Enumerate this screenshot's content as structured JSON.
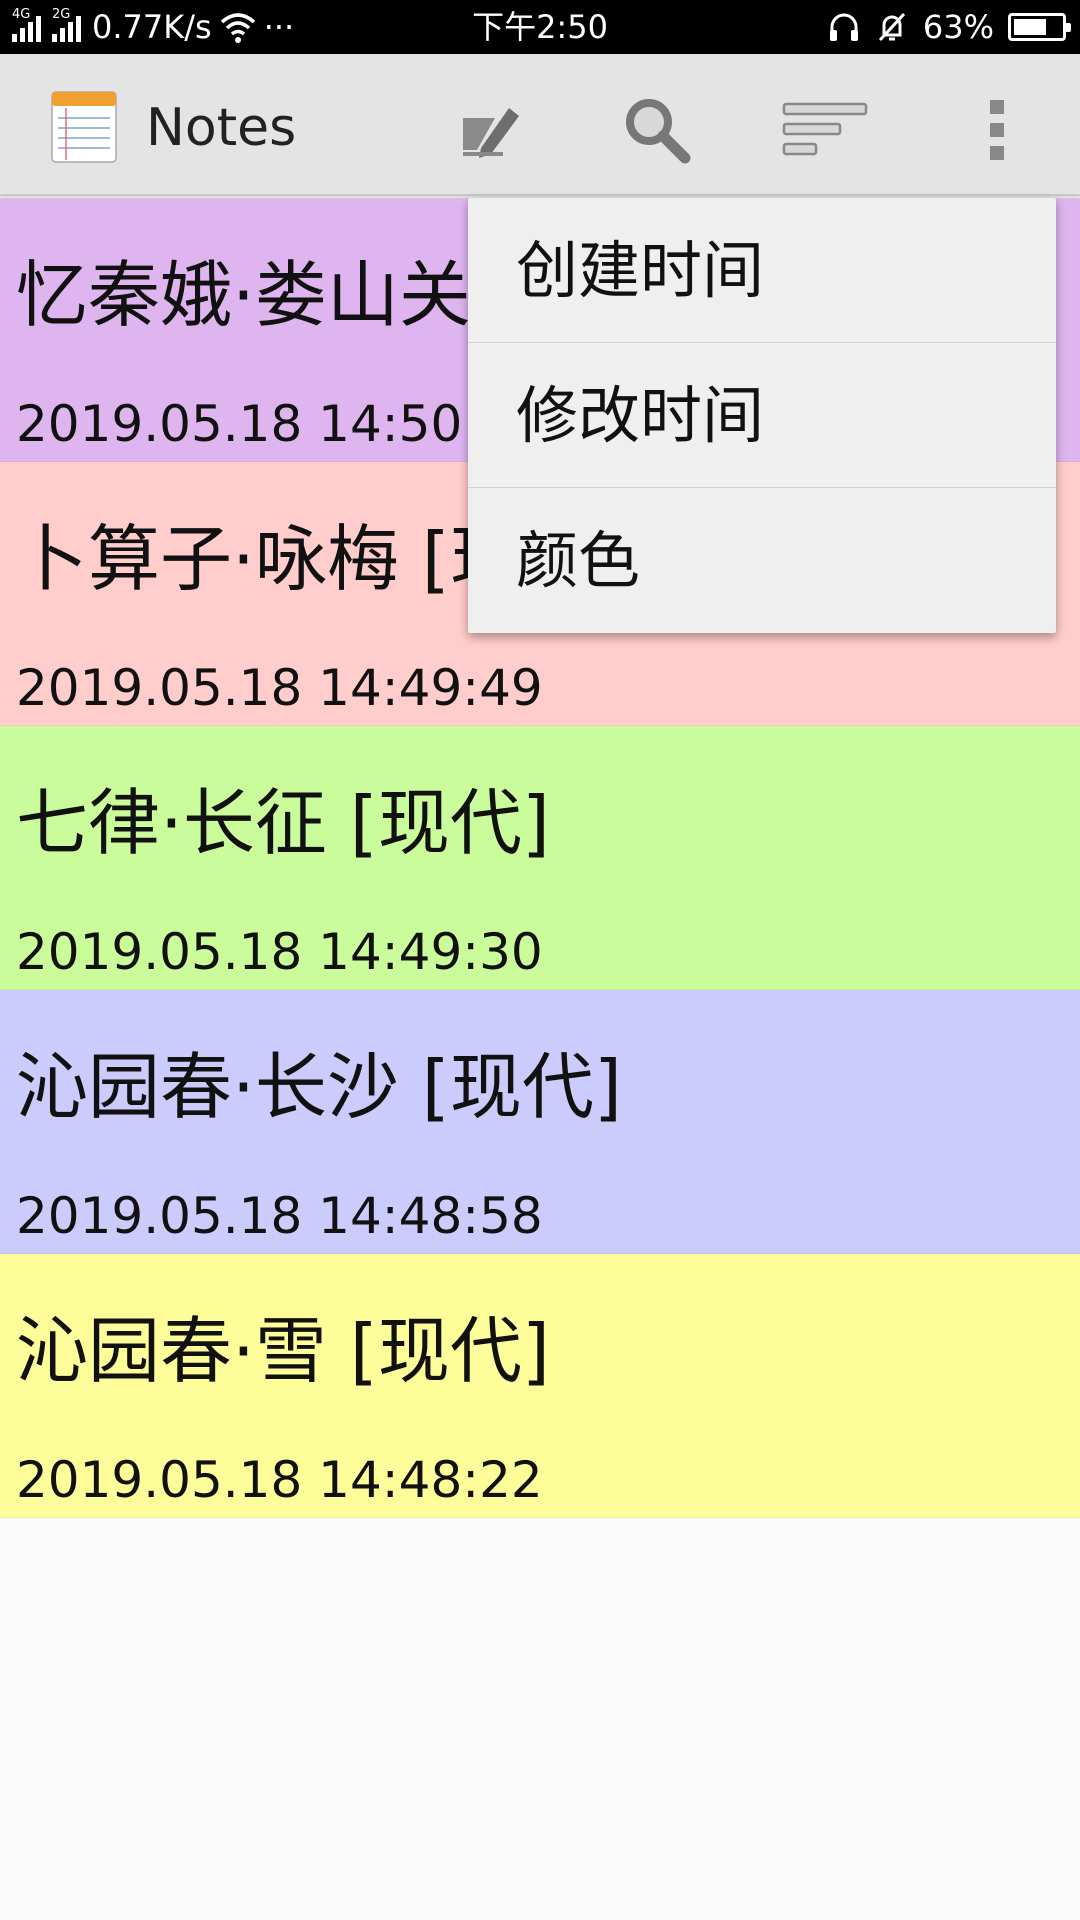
{
  "status_bar": {
    "network_1": "4G",
    "network_2": "2G",
    "speed": "0.77K/s",
    "more": "···",
    "time": "下午2:50",
    "battery": "63%",
    "icons": [
      "signal-icon",
      "wifi-icon",
      "headphone-icon",
      "mute-bell-icon",
      "battery-icon"
    ]
  },
  "action_bar": {
    "title": "Notes",
    "icons": [
      "notes-app-icon",
      "new-note-icon",
      "search-icon",
      "sort-icon",
      "overflow-menu-icon"
    ]
  },
  "notes": [
    {
      "title": "忆秦娥·娄山关 [现代]",
      "date": "2019.05.18 14:50:0",
      "color": "#dfb5f0"
    },
    {
      "title": "卜算子·咏梅 [现代]",
      "date": "2019.05.18 14:49:49",
      "color": "#ffcdcb"
    },
    {
      "title": "七律·长征 [现代]",
      "date": "2019.05.18 14:49:30",
      "color": "#cbfc9b"
    },
    {
      "title": "沁园春·长沙 [现代]",
      "date": "2019.05.18 14:48:58",
      "color": "#cbcbfc"
    },
    {
      "title": "沁园春·雪 [现代]",
      "date": "2019.05.18 14:48:22",
      "color": "#fdfd99"
    }
  ],
  "sort_menu": {
    "items": [
      "创建时间",
      "修改时间",
      "颜色"
    ]
  }
}
